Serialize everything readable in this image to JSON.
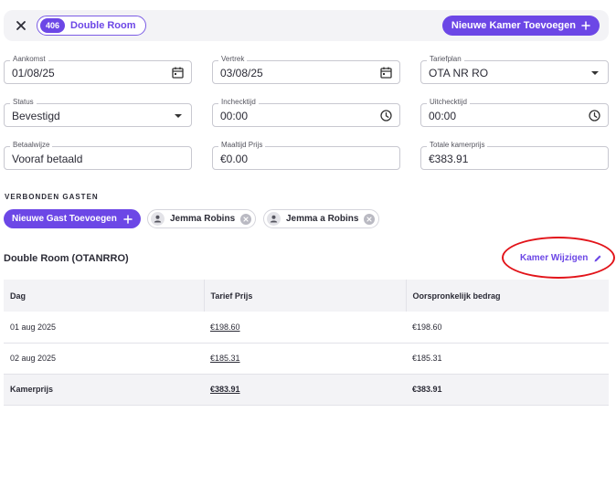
{
  "header": {
    "room_number": "406",
    "room_type": "Double Room",
    "add_room_label": "Nieuwe Kamer Toevoegen"
  },
  "form": {
    "arrival": {
      "label": "Aankomst",
      "value": "01/08/25"
    },
    "departure": {
      "label": "Vertrek",
      "value": "03/08/25"
    },
    "rate_plan": {
      "label": "Tariefplan",
      "value": "OTA NR RO"
    },
    "status": {
      "label": "Status",
      "value": "Bevestigd"
    },
    "checkin_time": {
      "label": "Inchecktijd",
      "value": "00:00"
    },
    "checkout_time": {
      "label": "Uitchecktijd",
      "value": "00:00"
    },
    "payment_method": {
      "label": "Betaalwijze",
      "value": "Vooraf betaald"
    },
    "meal_price": {
      "label": "Maaltijd Prijs",
      "value": "€0.00"
    },
    "total_room_price": {
      "label": "Totale kamerprijs",
      "value": "€383.91"
    }
  },
  "guests": {
    "title": "VERBONDEN GASTEN",
    "add_label": "Nieuwe Gast Toevoegen",
    "items": [
      {
        "name": "Jemma Robins"
      },
      {
        "name": "Jemma a Robins"
      }
    ]
  },
  "room_section": {
    "title": "Double Room (OTANRRO)",
    "edit_label": "Kamer Wijzigen"
  },
  "table": {
    "headers": [
      "Dag",
      "Tarief Prijs",
      "Oorspronkelijk bedrag"
    ],
    "rows": [
      {
        "day": "01 aug 2025",
        "rate": "€198.60",
        "original": "€198.60"
      },
      {
        "day": "02 aug 2025",
        "rate": "€185.31",
        "original": "€185.31"
      }
    ],
    "total": {
      "label": "Kamerprijs",
      "rate": "€383.91",
      "original": "€383.91"
    }
  },
  "colors": {
    "accent": "#6c47e6",
    "annotation": "#e2141a"
  }
}
